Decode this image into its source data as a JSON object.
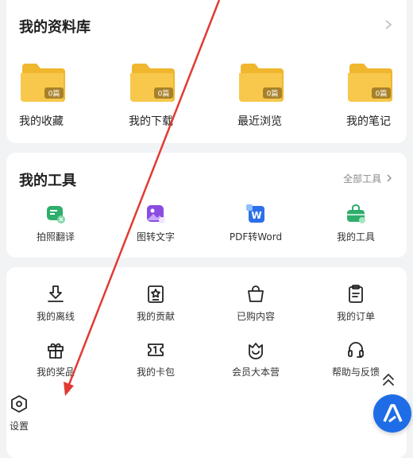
{
  "library": {
    "title": "我的资料库",
    "folders": [
      {
        "label": "我的收藏",
        "count": "0篇"
      },
      {
        "label": "我的下载",
        "count": "0篇"
      },
      {
        "label": "最近浏览",
        "count": "0篇"
      },
      {
        "label": "我的笔记",
        "count": "0篇"
      }
    ]
  },
  "tools": {
    "title": "我的工具",
    "more_label": "全部工具",
    "items": [
      {
        "label": "拍照翻译",
        "icon": "photo-translate-icon"
      },
      {
        "label": "图转文字",
        "icon": "image-to-text-icon"
      },
      {
        "label": "PDF转Word",
        "icon": "pdf-to-word-icon"
      },
      {
        "label": "我的工具",
        "icon": "toolbox-icon"
      }
    ]
  },
  "services": {
    "items": [
      {
        "label": "我的离线",
        "icon": "offline-download-icon"
      },
      {
        "label": "我的贡献",
        "icon": "contribution-icon"
      },
      {
        "label": "已购内容",
        "icon": "shopping-bag-icon"
      },
      {
        "label": "我的订单",
        "icon": "order-clipboard-icon"
      },
      {
        "label": "我的奖品",
        "icon": "gift-icon"
      },
      {
        "label": "我的卡包",
        "icon": "card-ticket-icon"
      },
      {
        "label": "会员大本营",
        "icon": "member-smile-icon"
      },
      {
        "label": "帮助与反馈",
        "icon": "headset-icon"
      },
      {
        "label": "设置",
        "icon": "settings-hexagon-icon"
      }
    ]
  },
  "colors": {
    "folder_yellow": "#f7c445",
    "folder_dark": "#e0a722",
    "accent_blue": "#1e6de6",
    "arrow_red": "#e23a33"
  }
}
